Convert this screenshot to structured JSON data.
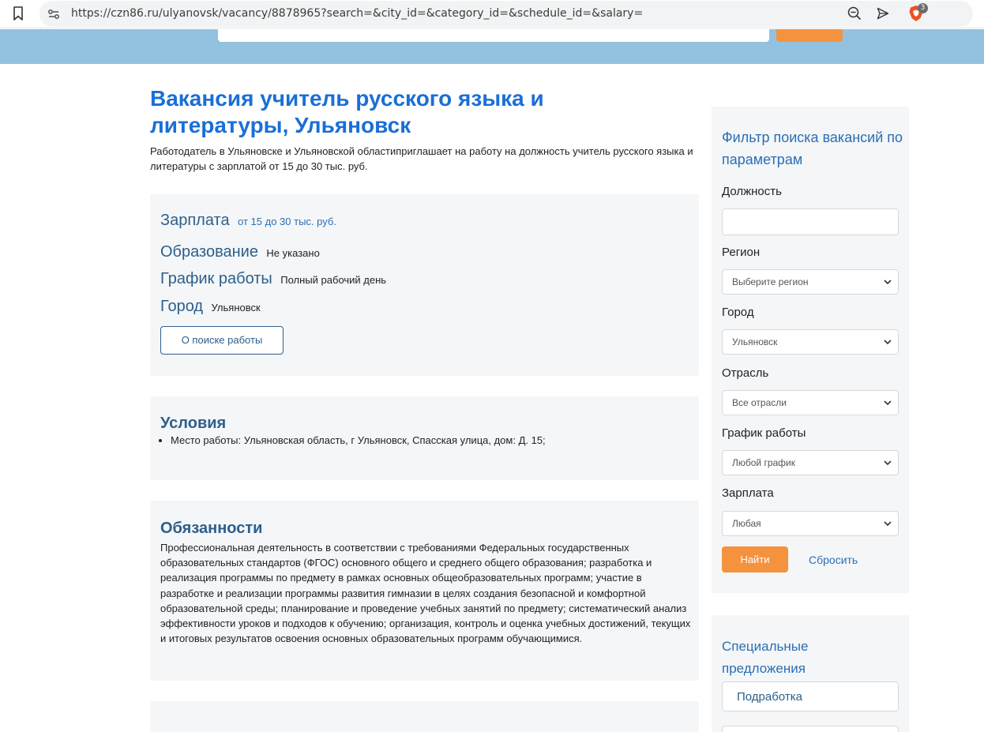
{
  "browser": {
    "url": "https://czn86.ru/ulyanovsk/vacancy/8878965?search=&city_id=&category_id=&schedule_id=&salary=",
    "badge_count": "3"
  },
  "page": {
    "title": "Вакансия учитель русского языка и литературы, Ульяновск",
    "intro": "Работодатель в Ульяновске и Ульяновской областиприглашает на работу на должность учитель русского языка и литературы с зарплатой от 15 до 30 тыс. руб."
  },
  "info": {
    "salary_label": "Зарплата",
    "salary_value": "от 15 до 30 тыс. руб.",
    "education_label": "Образование",
    "education_value": "Не указано",
    "schedule_label": "График работы",
    "schedule_value": "Полный рабочий день",
    "city_label": "Город",
    "city_value": "Ульяновск",
    "job_search_button": "О поиске работы"
  },
  "conditions": {
    "title": "Условия",
    "items": [
      "Место работы: Ульяновская область, г Ульяновск, Спасская улица, дом: Д. 15;"
    ]
  },
  "duties": {
    "title": "Обязанности",
    "text": "Профессиональная деятельность в соответствии с требованиями Федеральных государственных образовательных стандартов (ФГОС) основного общего и среднего общего образования; разработка и реализация программы по предмету в рамках основных общеобразовательных программ; участие в разработке и реализации программы развития гимназии в целях создания безопасной и комфортной образовательной среды; планирование и проведение учебных занятий по предмету; систематический анализ эффективности уроков и подходов к обучению; организация, контроль и оценка учебных достижений, текущих и итоговых результатов освоения основных образовательных программ обучающимися."
  },
  "filter": {
    "title": "Фильтр поиска вакансий по параметрам",
    "position_label": "Должность",
    "position_value": "",
    "region_label": "Регион",
    "region_value": "Выберите регион",
    "city_label": "Город",
    "city_value": "Ульяновск",
    "industry_label": "Отрасль",
    "industry_value": "Все отрасли",
    "schedule_label": "График работы",
    "schedule_value": "Любой график",
    "salary_label": "Зарплата",
    "salary_value": "Любая",
    "find_button": "Найти",
    "reset_link": "Сбросить"
  },
  "special": {
    "title": "Специальные предложения",
    "items": [
      "Подработка",
      ""
    ]
  },
  "colors": {
    "accent_blue": "#1a6fd6",
    "band_blue": "#93c2e0",
    "button_orange": "#f5923e",
    "panel_bg": "#f4f6f8"
  }
}
